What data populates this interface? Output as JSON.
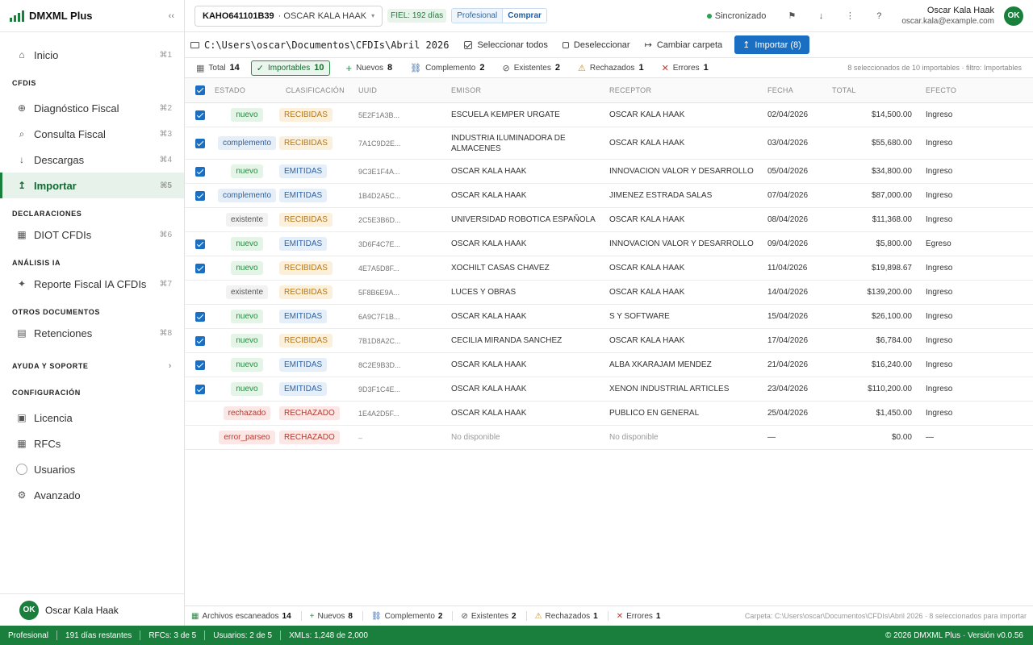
{
  "app": {
    "name": "DMXML Plus",
    "collapse": "‹‹"
  },
  "sidebar": {
    "inicio": {
      "label": "Inicio",
      "kbd": "⌘1"
    },
    "sec_cfdis": "CFDIS",
    "cfdis": [
      {
        "label": "Diagnóstico Fiscal",
        "kbd": "⌘2",
        "icon": "⊕"
      },
      {
        "label": "Consulta Fiscal",
        "kbd": "⌘3",
        "icon": "⌕"
      },
      {
        "label": "Descargas",
        "kbd": "⌘4",
        "icon": "↓"
      },
      {
        "label": "Importar",
        "kbd": "⌘5",
        "icon": "↥"
      }
    ],
    "sec_decl": "DECLARACIONES",
    "diot": {
      "label": "DIOT CFDIs",
      "kbd": "⌘6"
    },
    "sec_ia": "ANÁLISIS IA",
    "reporte": {
      "label": "Reporte Fiscal IA CFDIs",
      "kbd": "⌘7"
    },
    "sec_otros": "OTROS DOCUMENTOS",
    "retenciones": {
      "label": "Retenciones",
      "kbd": "⌘8"
    },
    "sec_ayuda": "AYUDA Y SOPORTE",
    "sec_config": "CONFIGURACIÓN",
    "config": [
      {
        "label": "Licencia"
      },
      {
        "label": "RFCs"
      },
      {
        "label": "Usuarios"
      },
      {
        "label": "Avanzado"
      }
    ],
    "user": {
      "initials": "OK",
      "name": "Oscar Kala Haak"
    }
  },
  "topbar": {
    "rfc": "KAHO641101B39",
    "rfc_name": "OSCAR KALA HAAK",
    "fiel": "FIEL: 192 días",
    "plan": "Profesional",
    "buy": "Comprar",
    "sync": "Sincronizado",
    "user_name": "Oscar Kala Haak",
    "user_email": "oscar.kala@example.com",
    "user_initials": "OK"
  },
  "pathbar": {
    "path": "C:\\Users\\oscar\\Documentos\\CFDIs\\Abril 2026",
    "select_all": "Seleccionar todos",
    "deselect": "Deseleccionar",
    "change_folder": "Cambiar carpeta",
    "import": "Importar (8)"
  },
  "filters": {
    "total": {
      "label": "Total",
      "count": "14"
    },
    "importables": {
      "label": "Importables",
      "count": "10"
    },
    "nuevos": {
      "label": "Nuevos",
      "count": "8"
    },
    "complemento": {
      "label": "Complemento",
      "count": "2"
    },
    "existentes": {
      "label": "Existentes",
      "count": "2"
    },
    "rechazados": {
      "label": "Rechazados",
      "count": "1"
    },
    "errores": {
      "label": "Errores",
      "count": "1"
    },
    "note": "8 seleccionados de 10 importables · filtro: Importables"
  },
  "table": {
    "headers": {
      "estado": "ESTADO",
      "clasificacion": "CLASIFICACIÓN",
      "uuid": "UUID",
      "emisor": "EMISOR",
      "receptor": "RECEPTOR",
      "fecha": "FECHA",
      "total": "TOTAL",
      "efecto": "EFECTO"
    },
    "rows": [
      {
        "checked": true,
        "estado": "nuevo",
        "clas": "RECIBIDAS",
        "uuid": "5E2F1A3B...",
        "emisor": "ESCUELA KEMPER URGATE",
        "receptor": "OSCAR KALA HAAK",
        "fecha": "02/04/2026",
        "total": "$14,500.00",
        "efecto": "Ingreso"
      },
      {
        "checked": true,
        "estado": "complemento",
        "clas": "RECIBIDAS",
        "uuid": "7A1C9D2E...",
        "emisor": "INDUSTRIA ILUMINADORA DE ALMACENES",
        "receptor": "OSCAR KALA HAAK",
        "fecha": "03/04/2026",
        "total": "$55,680.00",
        "efecto": "Ingreso"
      },
      {
        "checked": true,
        "estado": "nuevo",
        "clas": "EMITIDAS",
        "uuid": "9C3E1F4A...",
        "emisor": "OSCAR KALA HAAK",
        "receptor": "INNOVACION VALOR Y DESARROLLO",
        "fecha": "05/04/2026",
        "total": "$34,800.00",
        "efecto": "Ingreso"
      },
      {
        "checked": true,
        "estado": "complemento",
        "clas": "EMITIDAS",
        "uuid": "1B4D2A5C...",
        "emisor": "OSCAR KALA HAAK",
        "receptor": "JIMENEZ ESTRADA SALAS",
        "fecha": "07/04/2026",
        "total": "$87,000.00",
        "efecto": "Ingreso"
      },
      {
        "checked": false,
        "estado": "existente",
        "clas": "RECIBIDAS",
        "uuid": "2C5E3B6D...",
        "emisor": "UNIVERSIDAD ROBOTICA ESPAÑOLA",
        "receptor": "OSCAR KALA HAAK",
        "fecha": "08/04/2026",
        "total": "$11,368.00",
        "efecto": "Ingreso"
      },
      {
        "checked": true,
        "estado": "nuevo",
        "clas": "EMITIDAS",
        "uuid": "3D6F4C7E...",
        "emisor": "OSCAR KALA HAAK",
        "receptor": "INNOVACION VALOR Y DESARROLLO",
        "fecha": "09/04/2026",
        "total": "$5,800.00",
        "efecto": "Egreso"
      },
      {
        "checked": true,
        "estado": "nuevo",
        "clas": "RECIBIDAS",
        "uuid": "4E7A5D8F...",
        "emisor": "XOCHILT CASAS CHAVEZ",
        "receptor": "OSCAR KALA HAAK",
        "fecha": "11/04/2026",
        "total": "$19,898.67",
        "efecto": "Ingreso"
      },
      {
        "checked": false,
        "estado": "existente",
        "clas": "RECIBIDAS",
        "uuid": "5F8B6E9A...",
        "emisor": "LUCES Y OBRAS",
        "receptor": "OSCAR KALA HAAK",
        "fecha": "14/04/2026",
        "total": "$139,200.00",
        "efecto": "Ingreso"
      },
      {
        "checked": true,
        "estado": "nuevo",
        "clas": "EMITIDAS",
        "uuid": "6A9C7F1B...",
        "emisor": "OSCAR KALA HAAK",
        "receptor": "S Y SOFTWARE",
        "fecha": "15/04/2026",
        "total": "$26,100.00",
        "efecto": "Ingreso"
      },
      {
        "checked": true,
        "estado": "nuevo",
        "clas": "RECIBIDAS",
        "uuid": "7B1D8A2C...",
        "emisor": "CECILIA MIRANDA SANCHEZ",
        "receptor": "OSCAR KALA HAAK",
        "fecha": "17/04/2026",
        "total": "$6,784.00",
        "efecto": "Ingreso"
      },
      {
        "checked": true,
        "estado": "nuevo",
        "clas": "EMITIDAS",
        "uuid": "8C2E9B3D...",
        "emisor": "OSCAR KALA HAAK",
        "receptor": "ALBA XKARAJAM MENDEZ",
        "fecha": "21/04/2026",
        "total": "$16,240.00",
        "efecto": "Ingreso"
      },
      {
        "checked": true,
        "estado": "nuevo",
        "clas": "EMITIDAS",
        "uuid": "9D3F1C4E...",
        "emisor": "OSCAR KALA HAAK",
        "receptor": "XENON INDUSTRIAL ARTICLES",
        "fecha": "23/04/2026",
        "total": "$110,200.00",
        "efecto": "Ingreso"
      },
      {
        "checked": false,
        "estado": "rechazado",
        "clas": "RECHAZADO",
        "uuid": "1E4A2D5F...",
        "emisor": "OSCAR KALA HAAK",
        "receptor": "PUBLICO EN GENERAL",
        "fecha": "25/04/2026",
        "total": "$1,450.00",
        "efecto": "Ingreso"
      },
      {
        "checked": false,
        "estado": "error_parseo",
        "clas": "RECHAZADO",
        "uuid": "–",
        "emisor": "No disponible",
        "receptor": "No disponible",
        "fecha": "—",
        "total": "$0.00",
        "efecto": "—"
      }
    ]
  },
  "footer": {
    "scanned": {
      "label": "Archivos escaneados",
      "count": "14"
    },
    "nuevos": {
      "label": "Nuevos",
      "count": "8"
    },
    "complemento": {
      "label": "Complemento",
      "count": "2"
    },
    "existentes": {
      "label": "Existentes",
      "count": "2"
    },
    "rechazados": {
      "label": "Rechazados",
      "count": "1"
    },
    "errores": {
      "label": "Errores",
      "count": "1"
    },
    "path": "Carpeta: C:\\Users\\oscar\\Documentos\\CFDIs\\Abril 2026 · 8 seleccionados para importar"
  },
  "status": {
    "plan": "Profesional",
    "days": "191 días restantes",
    "rfcs": "RFCs: 3 de 5",
    "users": "Usuarios: 2 de 5",
    "xmls": "XMLs: 1,248 de 2,000",
    "copyright": "© 2026 DMXML Plus · Versión v0.0.56"
  },
  "colors": {
    "brand": "#1a7f3c",
    "accent": "#1a6fc2"
  }
}
